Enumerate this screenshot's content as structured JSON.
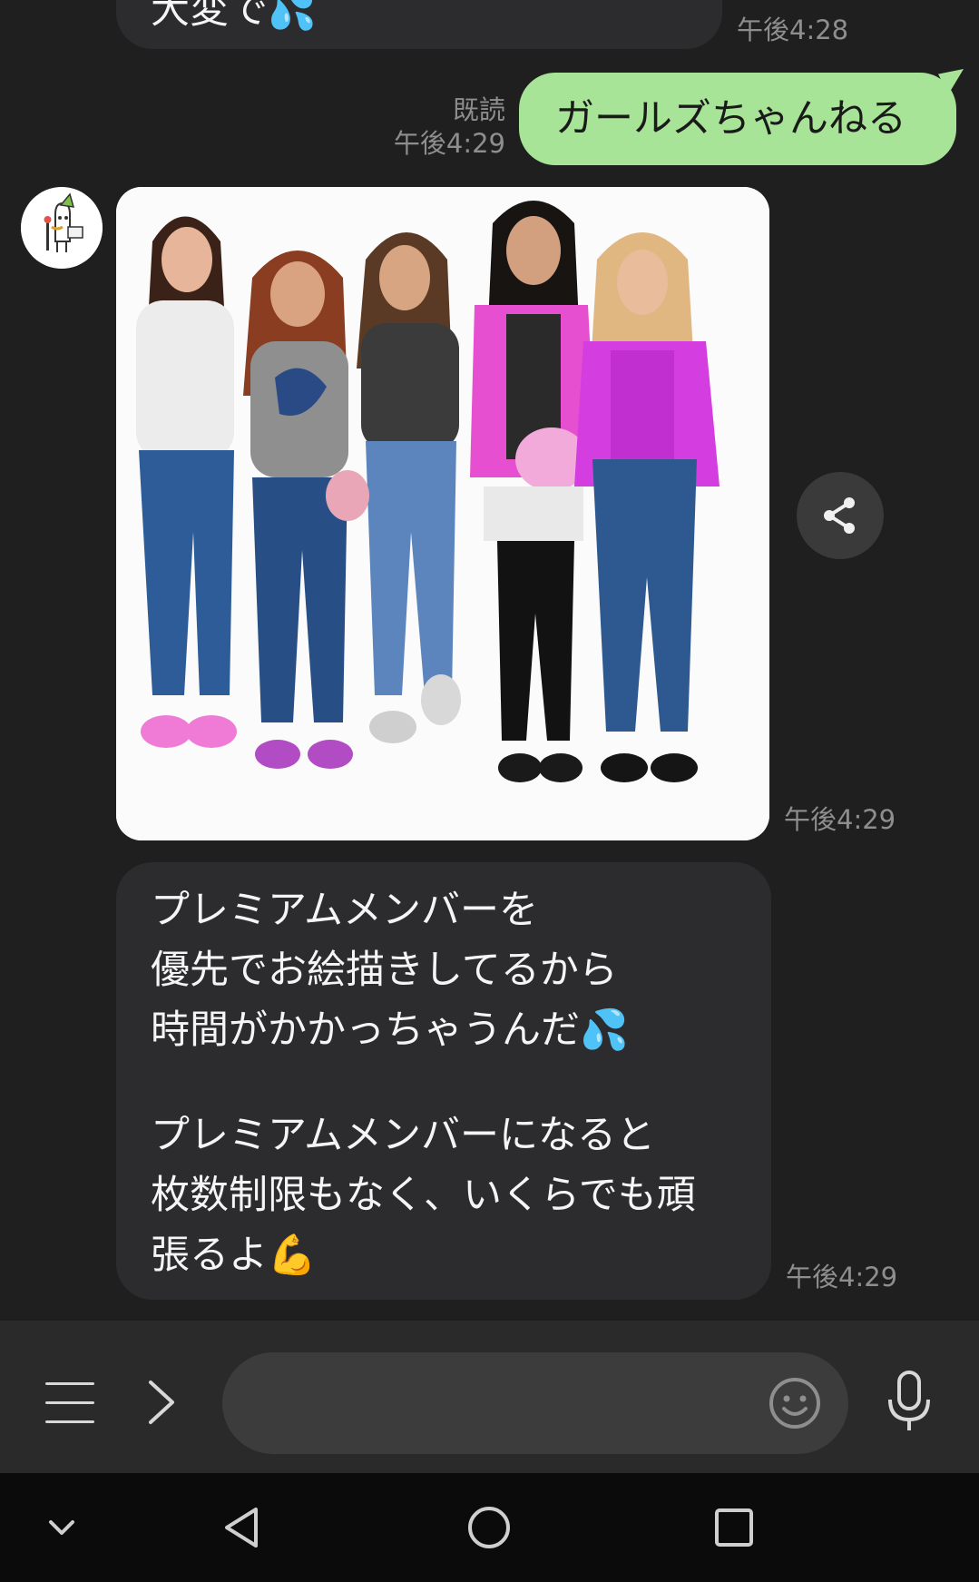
{
  "messages": {
    "top_partial": {
      "text": "大変で💦",
      "time": "午後4:28"
    },
    "outgoing": {
      "text": "ガールズちゃんねる",
      "read": "既読",
      "time": "午後4:29"
    },
    "image_message": {
      "time": "午後4:29"
    },
    "long_message": {
      "lines_a": [
        "プレミアムメンバーを",
        "優先でお絵描きしてるから",
        "時間がかかっちゃうんだ💦"
      ],
      "lines_b": [
        "プレミアムメンバーになると",
        "枚数制限もなく、いくらでも頑",
        "張るよ💪"
      ],
      "time": "午後4:29"
    }
  },
  "input_bar": {
    "placeholder": ""
  },
  "icons": {
    "avatar": "bot-avatar",
    "share": "share-icon",
    "menu": "menu-icon",
    "expand": "chevron-right-icon",
    "emoji": "emoji-icon",
    "mic": "microphone-icon"
  },
  "colors": {
    "outgoing_bubble": "#a8e497",
    "incoming_bubble": "#2c2c2e",
    "background": "#1f1f1f"
  }
}
